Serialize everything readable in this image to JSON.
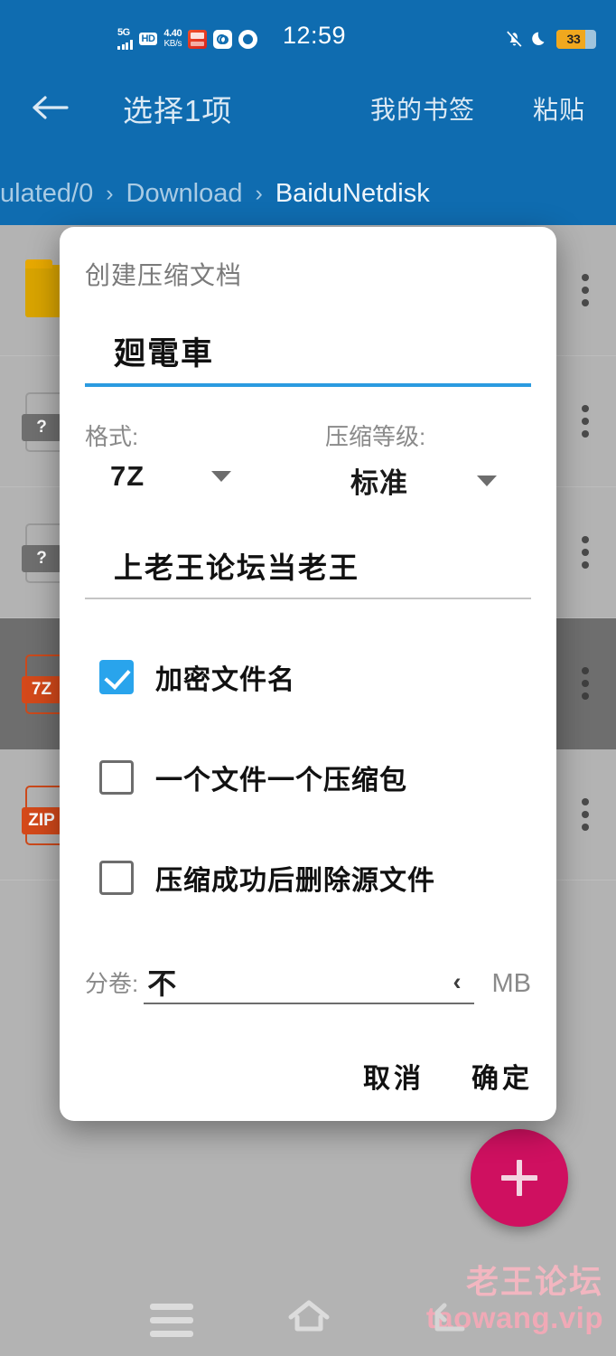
{
  "statusbar": {
    "network_type": "5G",
    "hd_badge": "HD",
    "net_speed_value": "4.40",
    "net_speed_unit": "KB/s",
    "clock": "12:59",
    "battery_percent": "33",
    "icons": [
      "signal-bars-icon",
      "hd-icon",
      "network-speed-icon",
      "wps-app-icon",
      "wh-app-icon",
      "chrome-app-icon",
      "bell-mute-icon",
      "moon-icon",
      "battery-icon"
    ]
  },
  "toolbar": {
    "back_label": "back-arrow",
    "title": "选择1项",
    "action_bookmarks": "我的书签",
    "action_paste": "粘贴"
  },
  "breadcrumb": {
    "items": [
      "ulated/0",
      "Download",
      "BaiduNetdisk"
    ],
    "separator": "›"
  },
  "filelist": {
    "rows": [
      {
        "icon": "folder-icon",
        "badge": "",
        "selected": false
      },
      {
        "icon": "document-unknown-icon",
        "badge": "?",
        "selected": false
      },
      {
        "icon": "document-unknown-icon",
        "badge": "?",
        "selected": false
      },
      {
        "icon": "archive-7z-icon",
        "badge": "7Z",
        "selected": true
      },
      {
        "icon": "archive-zip-icon",
        "badge": "ZIP",
        "selected": false
      }
    ]
  },
  "dialog": {
    "title": "创建压缩文档",
    "filename_value": "廻電車",
    "format_label": "格式:",
    "format_value": "7Z",
    "level_label": "压缩等级:",
    "level_value": "标准",
    "password_value": "上老王论坛当老王",
    "checkboxes": [
      {
        "label": "加密文件名",
        "checked": true
      },
      {
        "label": "一个文件一个压缩包",
        "checked": false
      },
      {
        "label": "压缩成功后删除源文件",
        "checked": false
      }
    ],
    "split_label": "分卷:",
    "split_value": "不",
    "split_chevron": "‹",
    "split_unit": "MB",
    "cancel_label": "取消",
    "confirm_label": "确定"
  },
  "fab": {
    "icon": "plus-icon",
    "color": "#cf1060"
  },
  "watermark": {
    "cn": "老王论坛",
    "en": "taowang.vip"
  },
  "navbar": {
    "recents": "recents-icon",
    "home": "home-icon",
    "back": "back-icon"
  },
  "colors": {
    "header_blue": "#0f6cb0",
    "accent_blue": "#2b9be0",
    "checkbox_blue": "#29a4ec",
    "fab_pink": "#cf1060",
    "background_gray": "#b3b3b3",
    "selected_row": "#6e6e6e",
    "battery_orange": "#f0a81e"
  }
}
